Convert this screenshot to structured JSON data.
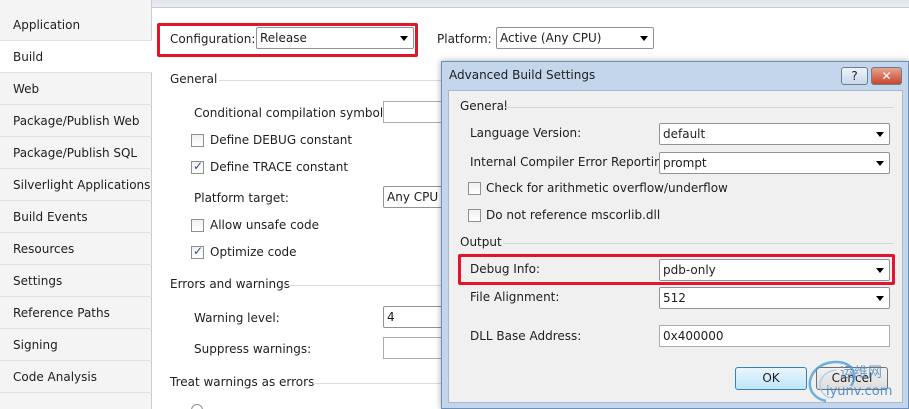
{
  "sidebar": {
    "items": [
      {
        "label": "Application"
      },
      {
        "label": "Build"
      },
      {
        "label": "Web"
      },
      {
        "label": "Package/Publish Web"
      },
      {
        "label": "Package/Publish SQL"
      },
      {
        "label": "Silverlight Applications"
      },
      {
        "label": "Build Events"
      },
      {
        "label": "Resources"
      },
      {
        "label": "Settings"
      },
      {
        "label": "Reference Paths"
      },
      {
        "label": "Signing"
      },
      {
        "label": "Code Analysis"
      }
    ],
    "active": "Build"
  },
  "header": {
    "configuration_label": "Configuration:",
    "configuration_value": "Release",
    "platform_label": "Platform:",
    "platform_value": "Active (Any CPU)"
  },
  "general": {
    "title": "General",
    "symbols_label": "Conditional compilation symbols:",
    "symbols_value": "",
    "define_debug_label": "Define DEBUG constant",
    "define_debug_checked": false,
    "define_trace_label": "Define TRACE constant",
    "define_trace_checked": true,
    "platform_target_label": "Platform target:",
    "platform_target_value": "Any CPU",
    "unsafe_label": "Allow unsafe code",
    "unsafe_checked": false,
    "optimize_label": "Optimize code",
    "optimize_checked": true
  },
  "errors": {
    "title": "Errors and warnings",
    "warning_level_label": "Warning level:",
    "warning_level_value": "4",
    "suppress_label": "Suppress warnings:",
    "suppress_value": ""
  },
  "treat_warnings": {
    "title": "Treat warnings as errors"
  },
  "dialog": {
    "title": "Advanced Build Settings",
    "help_label": "?",
    "close_label": "✕",
    "general_title": "General",
    "language_version_label": "Language Version:",
    "language_version_value": "default",
    "ice_label": "Internal Compiler Error Reporting:",
    "ice_value": "prompt",
    "overflow_label": "Check for arithmetic overflow/underflow",
    "overflow_checked": false,
    "mscorlib_label": "Do not reference mscorlib.dll",
    "mscorlib_checked": false,
    "output_title": "Output",
    "debug_info_label": "Debug Info:",
    "debug_info_value": "pdb-only",
    "file_alignment_label": "File Alignment:",
    "file_alignment_value": "512",
    "dll_base_label": "DLL Base Address:",
    "dll_base_value": "0x400000",
    "ok_label": "OK",
    "cancel_label": "Cancel"
  },
  "watermark": {
    "line1": "运维网",
    "line2": "iyunv.com"
  },
  "colors": {
    "highlight": "#e0162b",
    "dialog_frame": "#c4d6ec"
  }
}
